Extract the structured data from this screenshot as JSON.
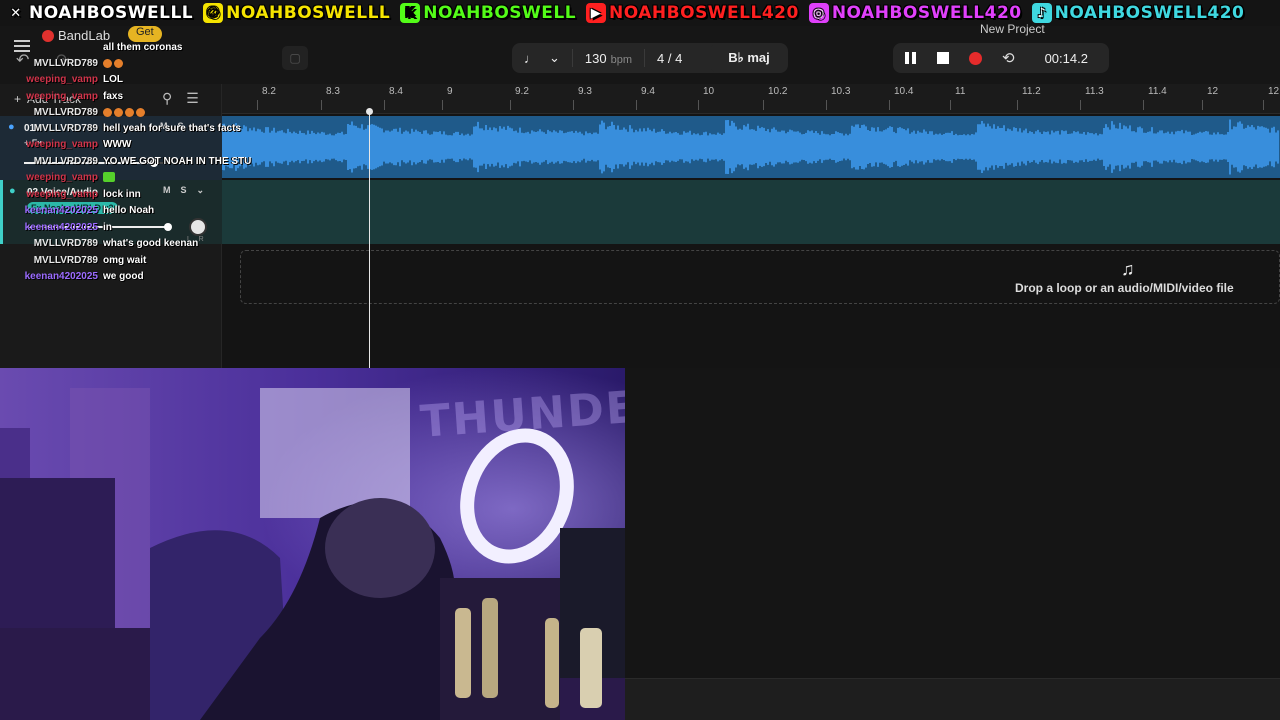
{
  "social": [
    {
      "platform": "x",
      "icon": "x-icon",
      "handle": "NOAHBOSWELLL",
      "color": "#ffffff"
    },
    {
      "platform": "snapchat",
      "icon": "snapchat-icon",
      "handle": "NOAHBOSWELLL",
      "color": "#f5e400"
    },
    {
      "platform": "kick",
      "icon": "kick-icon",
      "handle": "NOAHBOSWELL",
      "color": "#53fc18"
    },
    {
      "platform": "youtube",
      "icon": "youtube-icon",
      "handle": "NOAHBOSWELL420",
      "color": "#ff2020"
    },
    {
      "platform": "instagram",
      "icon": "instagram-icon",
      "handle": "NOAHBOSWELL420",
      "color": "#e040fb"
    },
    {
      "platform": "tiktok",
      "icon": "tiktok-icon",
      "handle": "NOAHBOSWELL420",
      "color": "#3fd8e0"
    }
  ],
  "app": {
    "logo": "BandLab",
    "get_label": "Get",
    "project_title": "New Project"
  },
  "toolbar": {
    "tempo": "130",
    "tempo_unit": "bpm",
    "time_signature": "4 / 4",
    "key": "B♭ maj",
    "time": "00:14.2"
  },
  "ruler": {
    "ticks": [
      "8.2",
      "8.3",
      "8.4",
      "9",
      "9.2",
      "9.3",
      "9.4",
      "10",
      "10.2",
      "10.3",
      "10.4",
      "11",
      "11.2",
      "11.3",
      "11.4",
      "12",
      "12.2"
    ]
  },
  "tracks": [
    {
      "number": "01",
      "name": "",
      "fx": "+ Fx",
      "mute": "M",
      "solo": "S",
      "volume": 0.9
    },
    {
      "number": "02",
      "name": "Voice/Audio",
      "fx": "Fx Noahs WRLD v2",
      "mute": "M",
      "solo": "S",
      "volume": 1.0
    }
  ],
  "add_track_label": "Add Track",
  "drop_zone": {
    "text": "Drop a loop or an audio/MIDI/video file"
  },
  "chat": [
    {
      "user": "",
      "text": "all them coronas",
      "color": "#ffffff"
    },
    {
      "user": "MVLLVRD789",
      "text": "",
      "emoji": 2,
      "color": "#e8e8e8"
    },
    {
      "user": "weeping_vamp",
      "text": "LOL",
      "color": "#d0344a"
    },
    {
      "user": "weeping_vamp",
      "text": "faxs",
      "color": "#d0344a"
    },
    {
      "user": "MVLLVRD789",
      "text": "",
      "emoji": 4,
      "color": "#e8e8e8"
    },
    {
      "user": "MVLLVRD789",
      "text": "hell yeah for sure that's facts",
      "color": "#e8e8e8"
    },
    {
      "user": "weeping_vamp",
      "text": "WWW",
      "color": "#d0344a"
    },
    {
      "user": "MVLLVRD789",
      "text": "YO WE GOT NOAH IN THE STU",
      "color": "#e8e8e8"
    },
    {
      "user": "weeping_vamp",
      "text": "",
      "color": "#d0344a",
      "emote": true
    },
    {
      "user": "weeping_vamp",
      "text": "lock inn",
      "color": "#d0344a"
    },
    {
      "user": "keenan4202025",
      "text": "hello Noah",
      "color": "#9b6bff"
    },
    {
      "user": "keenan4202025",
      "text": "in",
      "color": "#9b6bff"
    },
    {
      "user": "MVLLVRD789",
      "text": "what's good keenan",
      "color": "#e8e8e8"
    },
    {
      "user": "MVLLVRD789",
      "text": "omg wait",
      "color": "#e8e8e8"
    },
    {
      "user": "keenan4202025",
      "text": "we good",
      "color": "#9b6bff"
    }
  ]
}
